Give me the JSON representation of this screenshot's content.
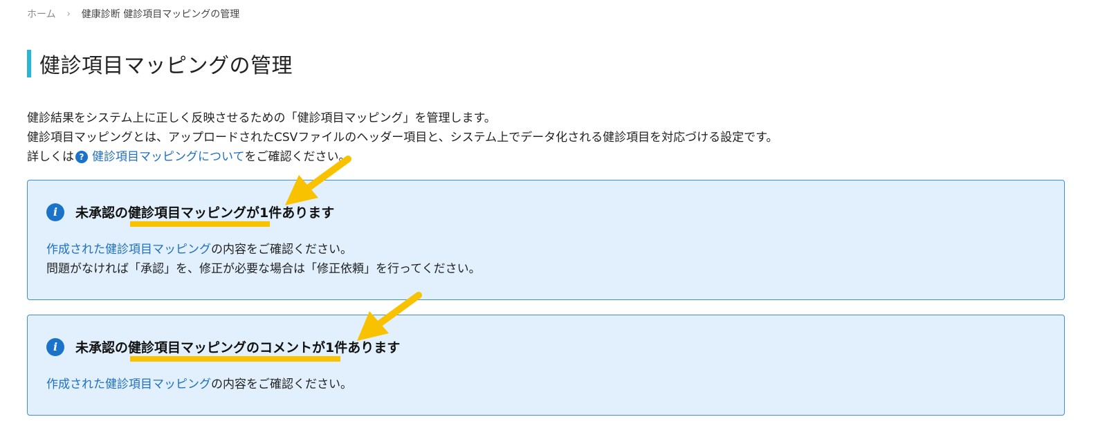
{
  "breadcrumb": {
    "home": "ホーム",
    "separator": "›",
    "current": "健康診断 健診項目マッピングの管理"
  },
  "page": {
    "title": "健診項目マッピングの管理"
  },
  "description": {
    "line1": "健診結果をシステム上に正しく反映させるための「健診項目マッピング」を管理します。",
    "line2": "健診項目マッピングとは、アップロードされたCSVファイルのヘッダー項目と、システム上でデータ化される健診項目を対応づける設定です。",
    "line3_prefix": "詳しくは",
    "help_icon_glyph": "?",
    "line3_link": "健診項目マッピングについて",
    "line3_suffix": "をご確認ください。"
  },
  "notices": [
    {
      "icon": "info-icon",
      "icon_glyph": "i",
      "title": "未承認の健診項目マッピングが1件あります",
      "link": "作成された健診項目マッピング",
      "line1_suffix": "の内容をご確認ください。",
      "line2": "問題がなければ「承認」を、修正が必要な場合は「修正依頼」を行ってください。"
    },
    {
      "icon": "info-icon",
      "icon_glyph": "i",
      "title": "未承認の健診項目マッピングのコメントが1件あります",
      "link": "作成された健診項目マッピング",
      "line1_suffix": "の内容をご確認ください。"
    }
  ],
  "colors": {
    "accent_bar": "#29b6d6",
    "link": "#1f6fc2",
    "notice_bg": "#e1f0fc",
    "notice_border": "#3d8fd6",
    "annotation": "#f9c200"
  }
}
